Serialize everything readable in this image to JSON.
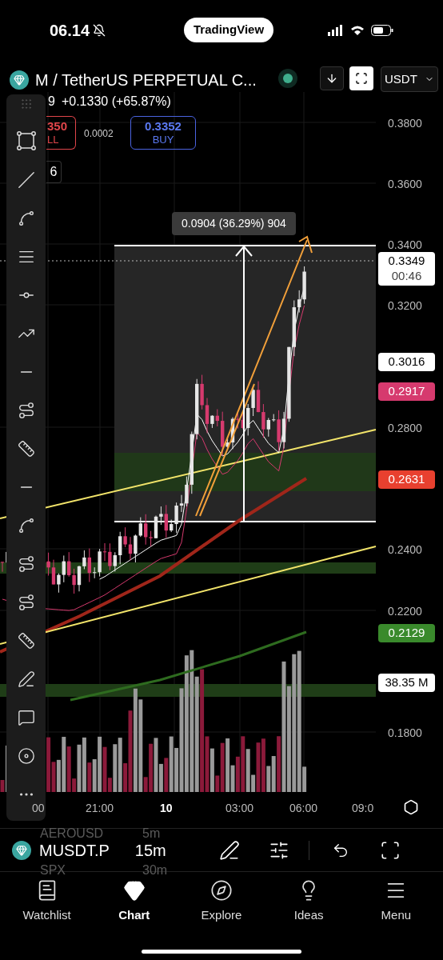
{
  "status_bar": {
    "time": "06.14",
    "app_pill": "TradingView"
  },
  "header": {
    "symbol": "M / TetherUS PERPETUAL C...",
    "market_open": true,
    "currency": "USDT",
    "frame_selected": true
  },
  "quote": {
    "last_fragment": "9",
    "change": "+0.1330 (+65.87%)",
    "sell_price": "350",
    "sell_label": "LL",
    "spread": "0.0002",
    "buy_price": "0.3352",
    "buy_label": "BUY",
    "indicator_fragment": "6"
  },
  "measure_label": "0.0904 (36.29%) 904",
  "price_axis": [
    "0.3800",
    "0.3600",
    "0.3400",
    "0.3200",
    "0.2800",
    "0.2400",
    "0.2200",
    "0.1800"
  ],
  "price_tags": [
    {
      "text": "0.3349",
      "sub": "00:46",
      "color": "#ffffff",
      "dark_text": true
    },
    {
      "text": "0.3016",
      "color": "#ffffff",
      "dark_text": true
    },
    {
      "text": "0.2917",
      "color": "#d63a6e",
      "dark_text": false
    },
    {
      "text": "0.2631",
      "color": "#e8402f",
      "dark_text": false
    },
    {
      "text": "0.2129",
      "color": "#3a8a2c",
      "dark_text": false
    },
    {
      "text": "38.35 M",
      "color": "#ffffff",
      "dark_text": true
    }
  ],
  "time_axis": [
    {
      "label": "00",
      "bold": false
    },
    {
      "label": "21:00",
      "bold": false
    },
    {
      "label": "10",
      "bold": true
    },
    {
      "label": "03:00",
      "bold": false
    },
    {
      "label": "06:00",
      "bold": false
    },
    {
      "label": "09:0",
      "bold": false
    }
  ],
  "symbol_bar": {
    "symbol": "MUSDT.P",
    "interval": "15m",
    "ghost_above": [
      "AEROUSD",
      "5m"
    ],
    "ghost_below": [
      "SPX",
      "30m"
    ]
  },
  "tabs": [
    {
      "label": "Watchlist",
      "selected": false
    },
    {
      "label": "Chart",
      "selected": true
    },
    {
      "label": "Explore",
      "selected": false
    },
    {
      "label": "Ideas",
      "selected": false
    },
    {
      "label": "Menu",
      "selected": false
    }
  ]
}
